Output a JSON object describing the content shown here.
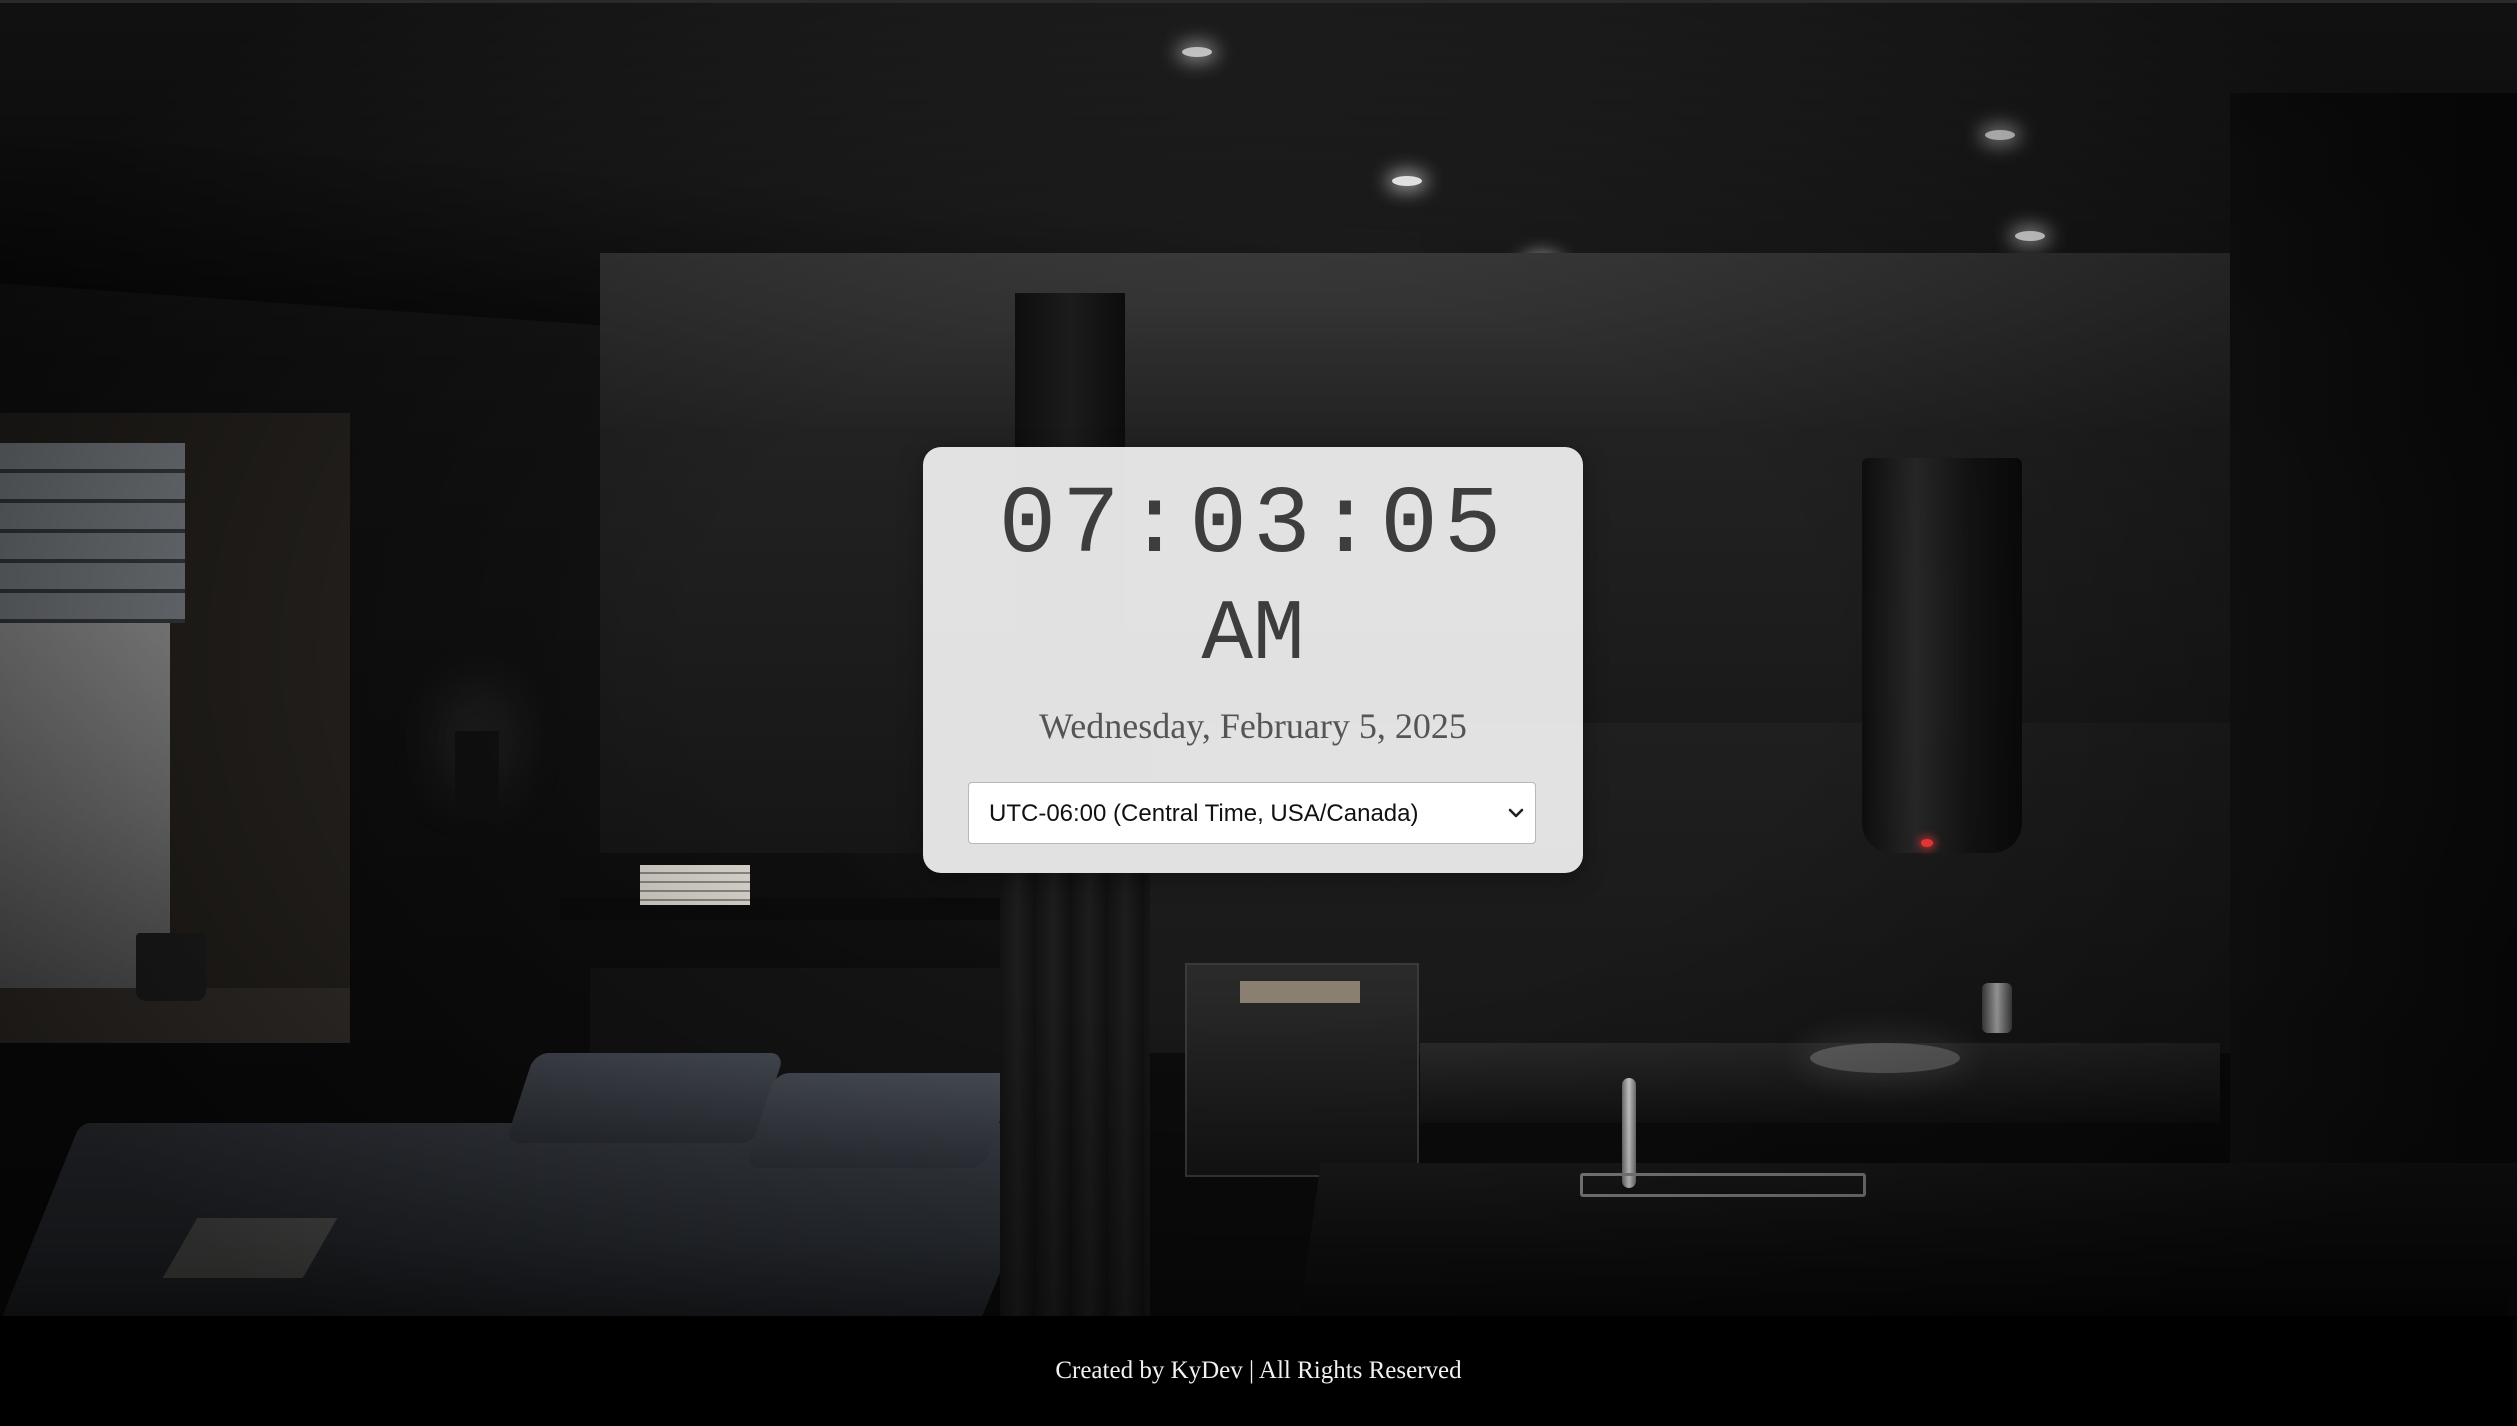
{
  "clock": {
    "time": "07:03:05",
    "period": "AM",
    "date": "Wednesday, February 5, 2025"
  },
  "timezone_select": {
    "selected": "UTC-06:00 (Central Time, USA/Canada)",
    "icon": "chevron-down-icon"
  },
  "footer": {
    "text": "Created by KyDev | All Rights Reserved"
  },
  "colors": {
    "card_background": "#e8e8e8",
    "clock_text": "#3d3d3d",
    "footer_background": "#000000",
    "footer_text": "#f2f2f2"
  }
}
